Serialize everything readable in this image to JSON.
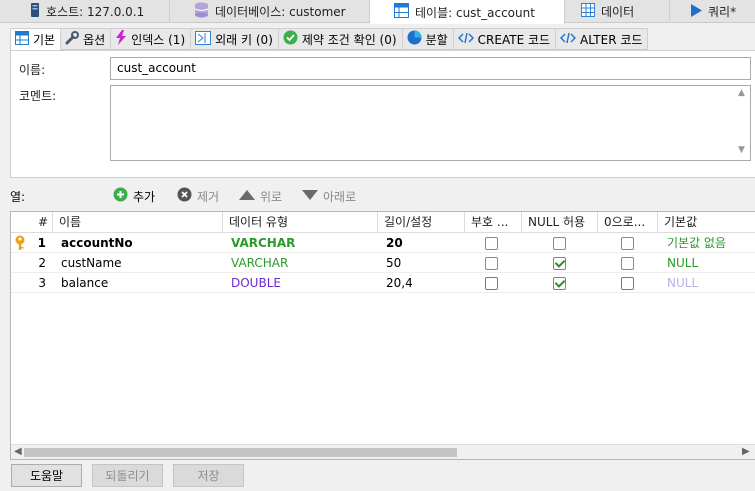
{
  "top_tabs": [
    {
      "label": "호스트: 127.0.0.1",
      "icon": "server-icon"
    },
    {
      "label": "데이터베이스: customer",
      "icon": "database-icon"
    },
    {
      "label": "테이블: cust_account",
      "icon": "table-icon",
      "active": true
    },
    {
      "label": "데이터",
      "icon": "grid-icon"
    },
    {
      "label": "쿼리*",
      "icon": "play-icon"
    }
  ],
  "inner_tabs": [
    {
      "label": "기본",
      "icon": "table-icon",
      "active": true
    },
    {
      "label": "옵션",
      "icon": "wrench-icon"
    },
    {
      "label": "인덱스 (1)",
      "icon": "lightning-icon"
    },
    {
      "label": "외래 키 (0)",
      "icon": "foreign-key-icon"
    },
    {
      "label": "제약 조건 확인 (0)",
      "icon": "check-icon"
    },
    {
      "label": "분할",
      "icon": "pie-icon"
    },
    {
      "label": "CREATE 코드",
      "icon": "code-icon"
    },
    {
      "label": "ALTER 코드",
      "icon": "code-icon"
    }
  ],
  "form": {
    "name_label": "이름:",
    "name_value": "cust_account",
    "comment_label": "코멘트:",
    "comment_value": ""
  },
  "columns_toolbar": {
    "label": "열:",
    "add": "추가",
    "remove": "제거",
    "up": "위로",
    "down": "아래로"
  },
  "grid": {
    "headers": [
      "#",
      "이름",
      "데이터 유형",
      "길이/설정",
      "부호 ...",
      "NULL 허용",
      "0으로...",
      "기본값"
    ],
    "rows": [
      {
        "num": "1",
        "name": "accountNo",
        "type": "VARCHAR",
        "length": "20",
        "unsigned": false,
        "nullable": false,
        "zerofill": false,
        "default": "기본값 없음",
        "primary_key": true
      },
      {
        "num": "2",
        "name": "custName",
        "type": "VARCHAR",
        "length": "50",
        "unsigned": false,
        "nullable": true,
        "zerofill": false,
        "default": "NULL"
      },
      {
        "num": "3",
        "name": "balance",
        "type": "DOUBLE",
        "length": "20,4",
        "unsigned": false,
        "nullable": true,
        "zerofill": false,
        "default": "NULL"
      }
    ]
  },
  "buttons": {
    "help": "도움말",
    "revert": "되돌리기",
    "save": "저장"
  },
  "colors": {
    "varchar": "#2a9a2a",
    "double": "#6a2bd0",
    "default_faded": "#b9b2e6"
  }
}
